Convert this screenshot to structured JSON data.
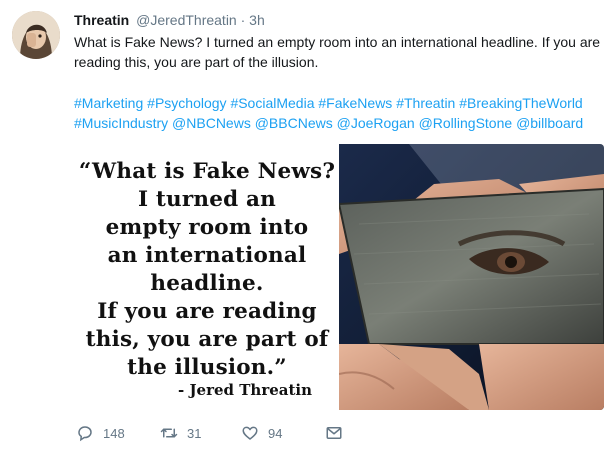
{
  "tweet": {
    "display_name": "Threatin",
    "handle": "@JeredThreatin",
    "separator": "·",
    "time": "3h",
    "text": "What is Fake News? I turned an empty room into an international headline. If you are reading this, you are part of the illusion.",
    "hashtags": [
      "#Marketing",
      "#Psychology",
      "#SocialMedia",
      "#FakeNews",
      "#Threatin",
      "#BreakingTheWorld",
      "#MusicIndustry",
      "@NBCNews",
      "@BBCNews",
      "@JoeRogan",
      "@RollingStone",
      "@billboard"
    ]
  },
  "media": {
    "quote_lines": [
      "“What is Fake News?",
      "I turned an",
      "empty room into",
      "an international",
      "headline.",
      "If you are reading",
      "this, you are part of",
      "the illusion.”"
    ],
    "author": "- Jered Threatin"
  },
  "actions": {
    "reply_count": "148",
    "retweet_count": "31",
    "like_count": "94",
    "reply_icon": "reply-icon",
    "retweet_icon": "retweet-icon",
    "like_icon": "heart-icon",
    "dm_icon": "envelope-icon"
  },
  "colors": {
    "link": "#1da1f2",
    "secondary": "#657786",
    "text": "#14171a"
  }
}
